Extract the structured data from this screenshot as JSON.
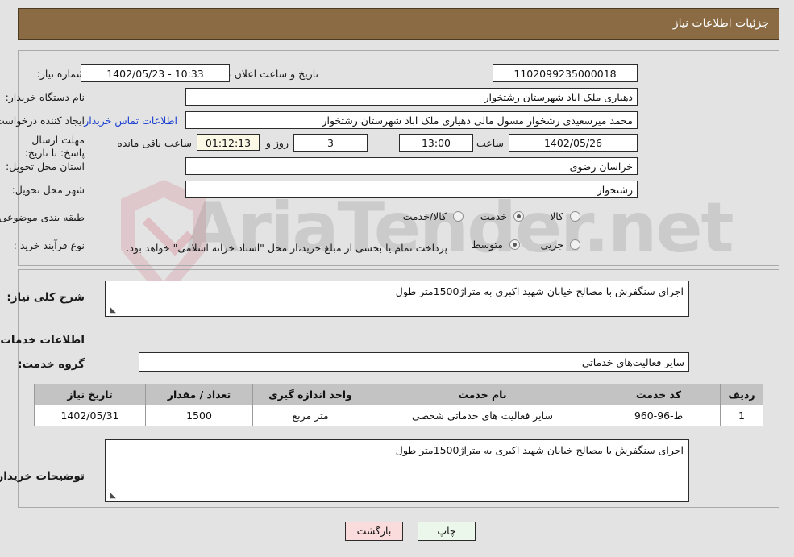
{
  "header": {
    "title": "جزئیات اطلاعات نیاز",
    "bar_color": "#8a6b43"
  },
  "watermark": {
    "text": "AriaTender.net",
    "logo": "shield-check-icon"
  },
  "form": {
    "need_number": {
      "label": "شماره نیاز:",
      "value": "1102099235000018"
    },
    "announce_datetime": {
      "label": "تاریخ و ساعت اعلان عمومی:",
      "value": "10:33 - 1402/05/23"
    },
    "buyer_org": {
      "label": "نام دستگاه خریدار:",
      "value": "دهیاری ملک اباد شهرستان رشتخوار"
    },
    "request_creator": {
      "label": "ایجاد کننده درخواست:",
      "value": "محمد میرسعیدی رشخوار مسول مالی دهیاری ملک اباد شهرستان رشتخوار"
    },
    "buyer_contact_link": "اطلاعات تماس خریدار",
    "deadline": {
      "label": "مهلت ارسال پاسخ: تا تاریخ:",
      "date": "1402/05/26",
      "hour_label": "ساعت",
      "hour": "13:00",
      "days": "3",
      "days_label": "روز و",
      "countdown": "01:12:13",
      "countdown_label": "ساعت باقی مانده"
    },
    "province": {
      "label": "استان محل تحویل:",
      "value": "خراسان رضوی"
    },
    "city": {
      "label": "شهر محل تحویل:",
      "value": "رشتخوار"
    },
    "category": {
      "label": "طبقه بندی موضوعی:",
      "options": [
        {
          "label": "کالا",
          "selected": false
        },
        {
          "label": "خدمت",
          "selected": true
        },
        {
          "label": "کالا/خدمت",
          "selected": false
        }
      ]
    },
    "purchase_type": {
      "label": "نوع فرآیند خرید :",
      "options": [
        {
          "label": "جزیی",
          "selected": false
        },
        {
          "label": "متوسط",
          "selected": true
        }
      ],
      "note": "پرداخت تمام یا بخشی از مبلغ خرید،از محل \"اسناد خزانه اسلامی\" خواهد بود."
    }
  },
  "description": {
    "general_label": "شرح کلی نیاز:",
    "general_value": "اجرای سنگفرش با مصالح خیابان شهید اکبری به متراژ1500متر طول",
    "services_section_title": "اطلاعات خدمات مورد نیاز",
    "service_group_label": "گروه خدمت:",
    "service_group_value": "سایر فعالیت‌های خدماتی",
    "buyer_notes_label": "توضیحات خریدار:",
    "buyer_notes_value": "اجرای سنگفرش با مصالح خیابان شهید اکبری به متراژ1500متر طول"
  },
  "table": {
    "columns": [
      "ردیف",
      "کد خدمت",
      "نام خدمت",
      "واحد اندازه گیری",
      "تعداد / مقدار",
      "تاریخ نیاز"
    ],
    "rows": [
      {
        "row": "1",
        "code": "ط-96-960",
        "name": "سایر فعالیت های خدماتی شخصی",
        "unit": "متر مربع",
        "qty": "1500",
        "date": "1402/05/31"
      }
    ]
  },
  "buttons": {
    "print": "چاپ",
    "back": "بازگشت",
    "print_color": "#eaf7ea",
    "back_color": "#fbdcdc"
  }
}
